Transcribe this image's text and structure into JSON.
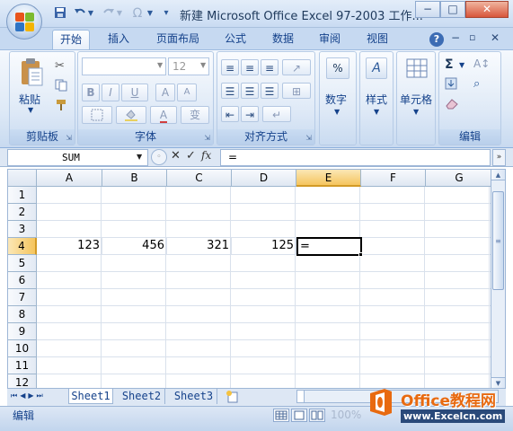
{
  "window": {
    "title": "新建 Microsoft Office Excel 97-2003 工作...",
    "minimize": "−",
    "maximize": "□",
    "close": "✕"
  },
  "quick_access": [
    "save-icon",
    "undo-icon",
    "dropdown-icon",
    "redo-icon",
    "repeat-icon",
    "customize-icon"
  ],
  "tabs": [
    {
      "label": "开始",
      "active": true
    },
    {
      "label": "插入"
    },
    {
      "label": "页面布局"
    },
    {
      "label": "公式"
    },
    {
      "label": "数据"
    },
    {
      "label": "审阅"
    },
    {
      "label": "视图"
    }
  ],
  "ribbon": {
    "clipboard": {
      "label": "剪贴板",
      "paste": "粘贴"
    },
    "font": {
      "label": "字体",
      "font_name": "",
      "font_size": "12",
      "bold": "B",
      "italic": "I",
      "underline": "U",
      "grow": "A",
      "shrink": "A",
      "change_case": "变"
    },
    "alignment": {
      "label": "对齐方式"
    },
    "number": {
      "label": "数字",
      "icon_text": "%"
    },
    "styles": {
      "label": "样式",
      "icon_text": "A"
    },
    "cells": {
      "label": "单元格"
    },
    "editing": {
      "label": "编辑",
      "autosum": "Σ"
    }
  },
  "formula_bar": {
    "name_box": "SUM",
    "cancel": "✕",
    "enter": "✓",
    "function": "fx",
    "content": "="
  },
  "sheet": {
    "columns": [
      "A",
      "B",
      "C",
      "D",
      "E",
      "F",
      "G"
    ],
    "rows": [
      "1",
      "2",
      "3",
      "4",
      "5",
      "6",
      "7",
      "8",
      "9",
      "10",
      "11",
      "12"
    ],
    "active_column": "E",
    "active_row": "4",
    "cells": {
      "A4": "123",
      "B4": "456",
      "C4": "321",
      "D4": "125",
      "E4": "="
    }
  },
  "sheet_tabs": [
    "Sheet1",
    "Sheet2",
    "Sheet3"
  ],
  "active_sheet": "Sheet1",
  "status": {
    "mode": "编辑",
    "zoom": "100%"
  },
  "watermark": {
    "brand": "Office教程网",
    "url": "www.Excelcn.com"
  },
  "colors": {
    "accent": "#15428b",
    "ribbon": "#dfeaf7",
    "active_header": "#f8d88c",
    "watermark_orange": "#e86a10"
  }
}
